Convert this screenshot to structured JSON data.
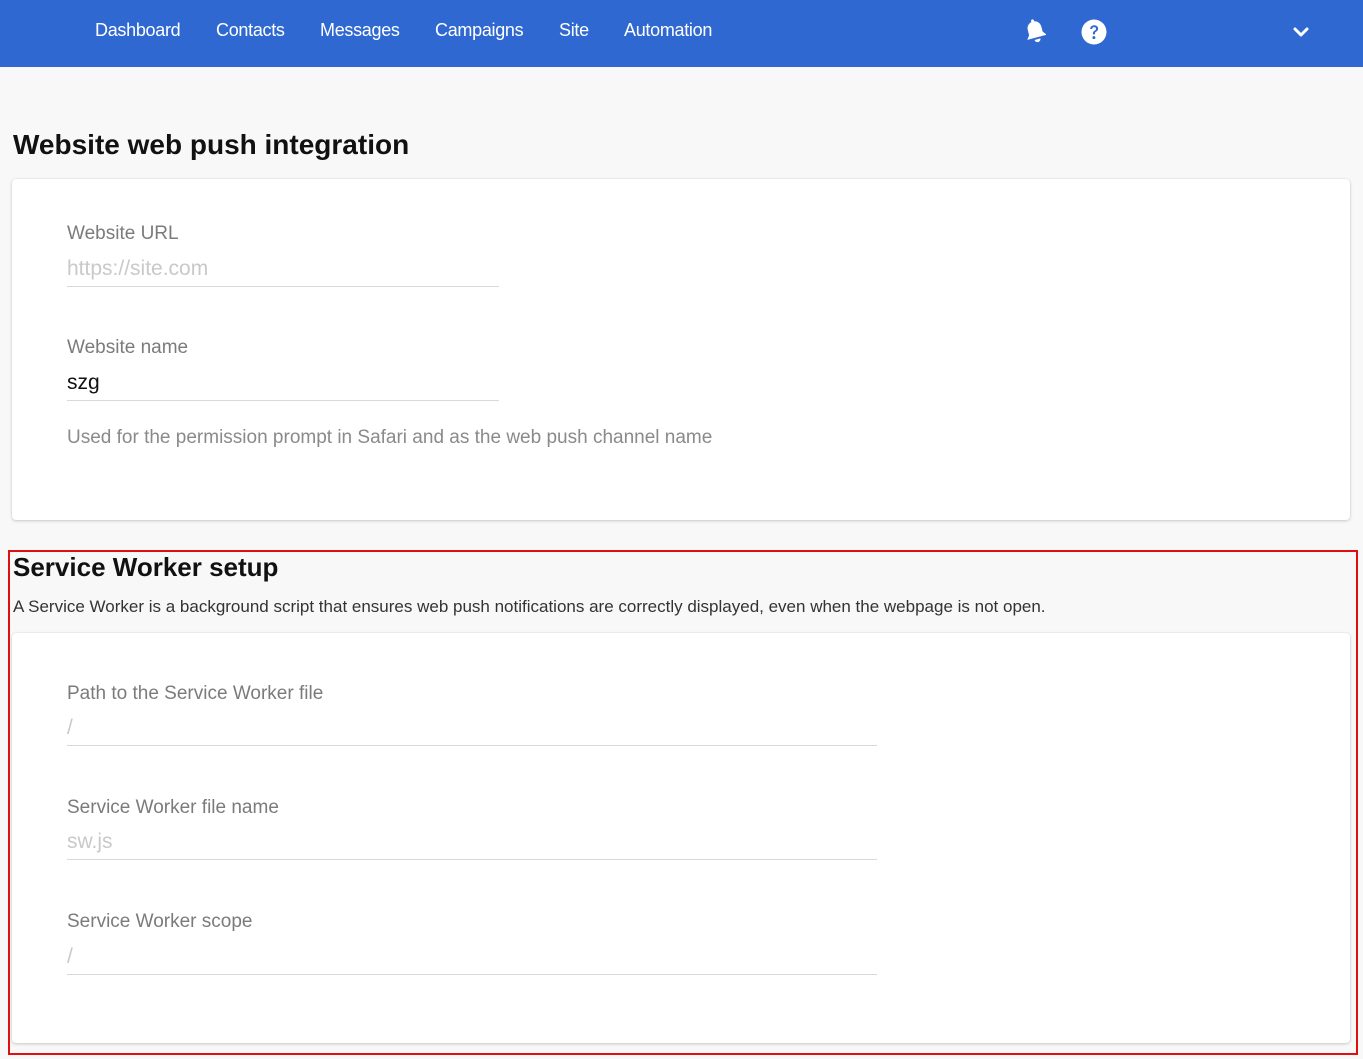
{
  "nav": {
    "items": [
      {
        "label": "Dashboard"
      },
      {
        "label": "Contacts"
      },
      {
        "label": "Messages"
      },
      {
        "label": "Campaigns"
      },
      {
        "label": "Site"
      },
      {
        "label": "Automation"
      }
    ],
    "icons": [
      "bell-icon",
      "help-icon",
      "chevron-down-icon"
    ],
    "background": "#2f68d1"
  },
  "page": {
    "title": "Website web push integration"
  },
  "website_card": {
    "url_label": "Website URL",
    "url_placeholder": "https://site.com",
    "url_value": "",
    "name_label": "Website name",
    "name_value": "szg",
    "name_helper": "Used for the permission prompt in Safari and as the web push channel name"
  },
  "service_worker": {
    "title": "Service Worker setup",
    "description": "A Service Worker is a background script that ensures web push notifications are correctly displayed, even when the webpage is not open.",
    "path_label": "Path to the Service Worker file",
    "path_placeholder": "/",
    "file_label": "Service Worker file name",
    "file_placeholder": "sw.js",
    "scope_label": "Service Worker scope",
    "scope_placeholder": "/"
  },
  "highlight_color": "#e01010"
}
